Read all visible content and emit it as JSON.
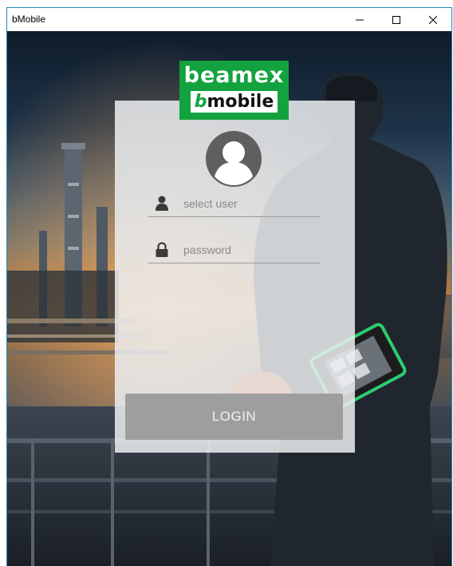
{
  "window": {
    "title": "bMobile",
    "controls": [
      "minimize",
      "maximize",
      "close"
    ]
  },
  "logo": {
    "line1": "beamex",
    "line2_prefix": "b",
    "line2_rest": "mobile",
    "color": "#12a23e"
  },
  "login": {
    "user_placeholder": "select user",
    "password_placeholder": "password",
    "button_label": "LOGIN"
  },
  "icons": {
    "avatar": "user-avatar-icon",
    "user": "person-icon",
    "password": "lock-icon"
  },
  "colors": {
    "button": "#9e9e9e",
    "card": "#ebedf0",
    "title_border": "#1a8fb4"
  }
}
